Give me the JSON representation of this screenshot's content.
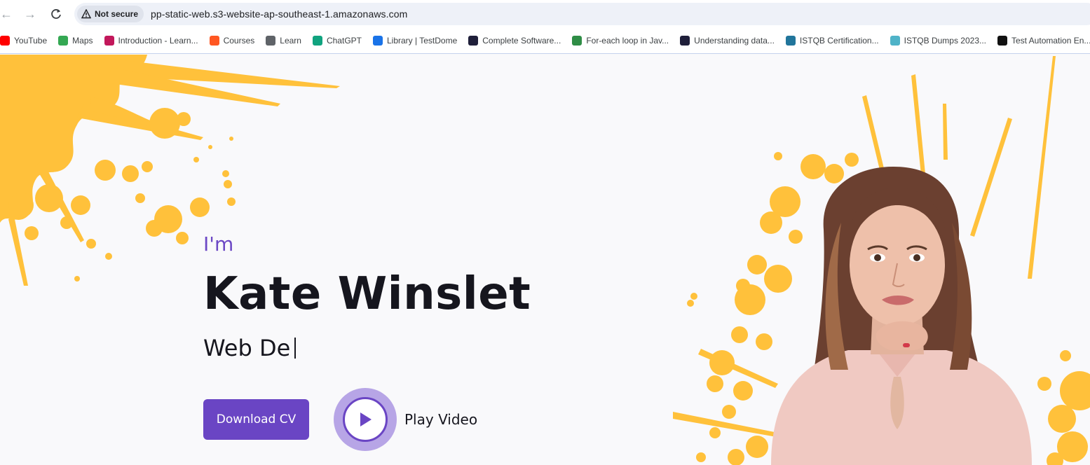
{
  "browser": {
    "security_label": "Not secure",
    "url": "pp-static-web.s3-website-ap-southeast-1.amazonaws.com",
    "bookmarks": [
      {
        "label": "YouTube",
        "icon": "youtube-icon",
        "color": "#ff0000"
      },
      {
        "label": "Maps",
        "icon": "maps-icon",
        "color": "#34a853"
      },
      {
        "label": "Introduction - Learn...",
        "icon": "learn-icon",
        "color": "#c2185b"
      },
      {
        "label": "Courses",
        "icon": "fire-icon",
        "color": "#ff5722"
      },
      {
        "label": "Learn",
        "icon": "folder-icon",
        "color": "#5f6368"
      },
      {
        "label": "ChatGPT",
        "icon": "chatgpt-icon",
        "color": "#10a37f"
      },
      {
        "label": "Library | TestDome",
        "icon": "testdome-icon",
        "color": "#1a73e8"
      },
      {
        "label": "Complete Software...",
        "icon": "shield-icon",
        "color": "#1f1f3a"
      },
      {
        "label": "For-each loop in Jav...",
        "icon": "gfg-icon",
        "color": "#2f8d46"
      },
      {
        "label": "Understanding data...",
        "icon": "shield-icon",
        "color": "#1f1f3a"
      },
      {
        "label": "ISTQB Certification...",
        "icon": "wordpress-icon",
        "color": "#21759b"
      },
      {
        "label": "ISTQB Dumps 2023...",
        "icon": "istqb-icon",
        "color": "#4fb3c8"
      },
      {
        "label": "Test Automation En...",
        "icon": "db-icon",
        "color": "#111111"
      }
    ]
  },
  "hero": {
    "intro": "I'm",
    "name": "Kate Winslet",
    "role": "Web De",
    "download_label": "Download CV",
    "play_label": "Play Video"
  },
  "colors": {
    "accent": "#6a45c4",
    "splash": "#ffc13b",
    "text": "#16161e"
  }
}
